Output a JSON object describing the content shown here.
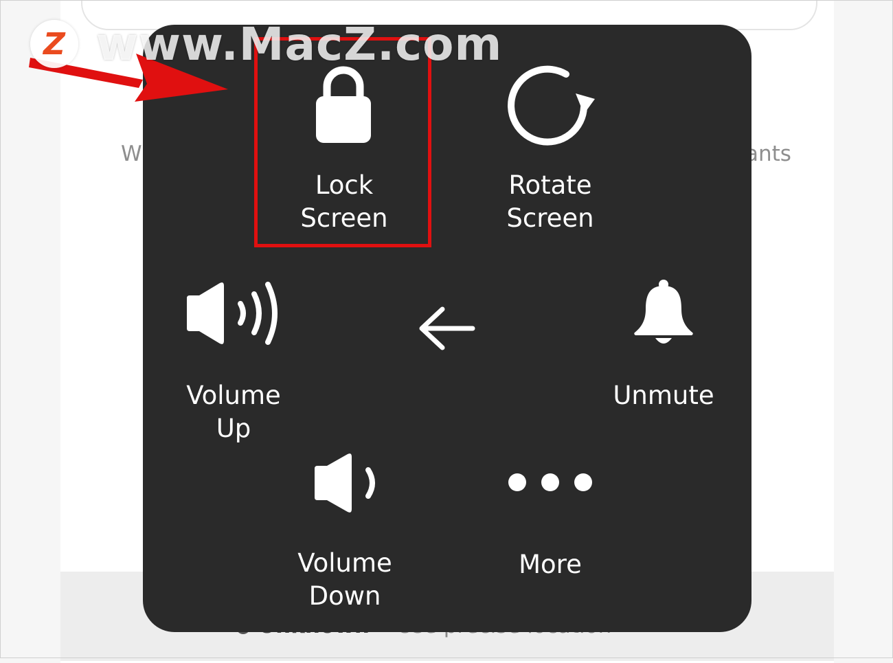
{
  "background": {
    "left_fragment": "W",
    "right_fragment": "ants",
    "location_option": "Unknown",
    "location_desc": "Use precise location"
  },
  "watermark": {
    "logo_letter": "Z",
    "text": "www.MacZ.com"
  },
  "menu": {
    "lock_screen": {
      "line1": "Lock",
      "line2": "Screen",
      "icon": "lock-icon"
    },
    "rotate_screen": {
      "line1": "Rotate",
      "line2": "Screen",
      "icon": "rotate-icon"
    },
    "volume_up": {
      "line1": "Volume",
      "line2": "Up",
      "icon": "speaker-loud-icon"
    },
    "back": {
      "icon": "back-arrow-icon"
    },
    "unmute": {
      "line1": "Unmute",
      "icon": "bell-icon"
    },
    "volume_down": {
      "line1": "Volume",
      "line2": "Down",
      "icon": "speaker-quiet-icon"
    },
    "more": {
      "line1": "More",
      "icon": "ellipsis-icon"
    }
  },
  "annotation": {
    "highlight_color": "#e01010",
    "arrow_color": "#e01010"
  },
  "colors": {
    "panel": "#2a2a2a",
    "text": "#ffffff"
  }
}
